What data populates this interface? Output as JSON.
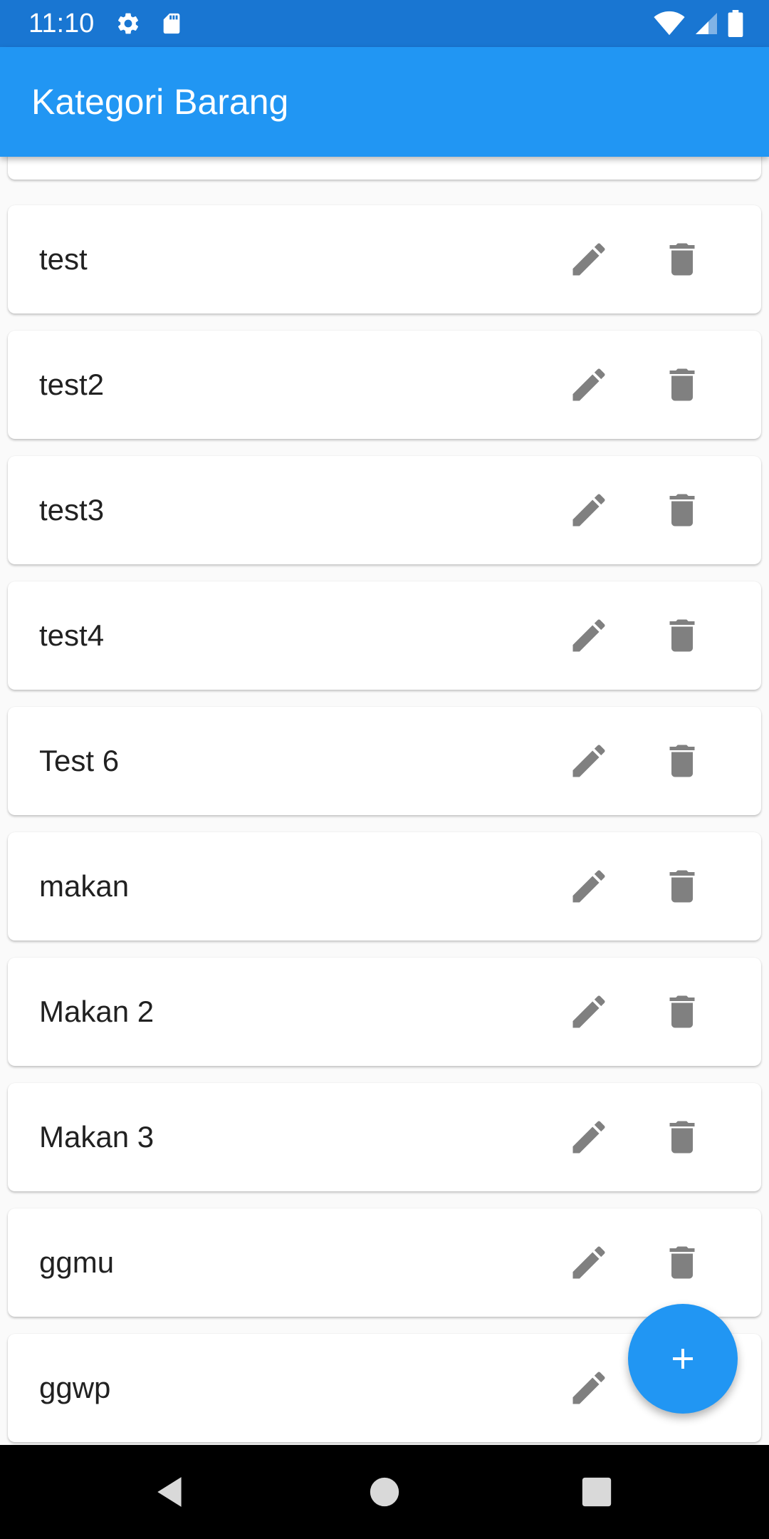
{
  "status_bar": {
    "time": "11:10"
  },
  "app_bar": {
    "title": "Kategori Barang"
  },
  "categories": [
    {
      "name": ""
    },
    {
      "name": "test"
    },
    {
      "name": "test2"
    },
    {
      "name": "test3"
    },
    {
      "name": "test4"
    },
    {
      "name": "Test 6"
    },
    {
      "name": "makan"
    },
    {
      "name": "Makan 2"
    },
    {
      "name": "Makan 3"
    },
    {
      "name": "ggmu"
    },
    {
      "name": "ggwp"
    }
  ],
  "icons": {
    "edit": "pencil-icon",
    "delete": "trash-icon",
    "fab": "plus-icon"
  },
  "colors": {
    "status_bar": "#1976d2",
    "app_bar": "#2196f3",
    "fab": "#2196f3",
    "icon_gray": "#808080",
    "background": "#fafafa"
  }
}
